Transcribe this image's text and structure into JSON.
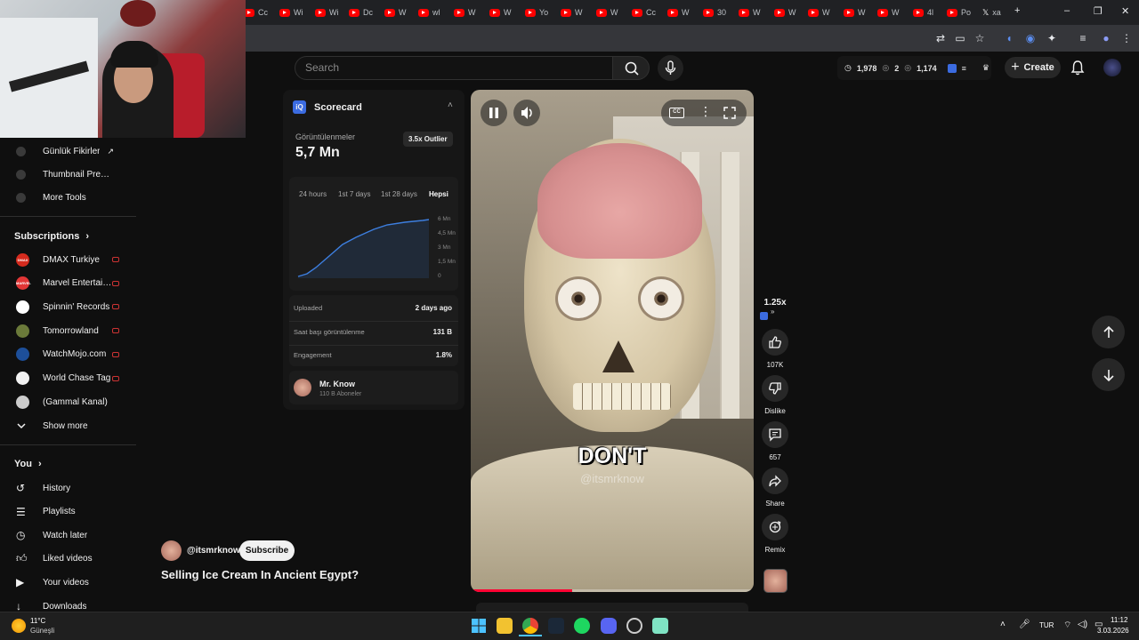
{
  "browser": {
    "tabs": [
      "Cc",
      "Wi",
      "Wi",
      "Dc",
      "W",
      "wl",
      "W",
      "W",
      "Yo",
      "W",
      "W",
      "Cc",
      "W",
      "30",
      "W",
      "W",
      "W",
      "W",
      "W",
      "4l",
      "Po",
      "xa"
    ],
    "new_tab": "+",
    "window_controls": [
      "–",
      "❐",
      "✕"
    ]
  },
  "header": {
    "search_placeholder": "Search",
    "stats": {
      "value1": "1,978",
      "value2": "2",
      "value3": "1,174"
    },
    "create_label": "Create"
  },
  "sidebar": {
    "tools": [
      {
        "label": "Günlük Fikirler",
        "icon": "external-link-icon"
      },
      {
        "label": "Thumbnail Preview"
      },
      {
        "label": "More Tools"
      }
    ],
    "subscriptions_title": "Subscriptions",
    "subscriptions": [
      {
        "label": "DMAX Turkiye",
        "color": "#d52b1e",
        "badge": "DMAX"
      },
      {
        "label": "Marvel Entertain...",
        "color": "#e23636",
        "badge": "MARVEL"
      },
      {
        "label": "Spinnin' Records",
        "color": "#ffffff",
        "badge": "S"
      },
      {
        "label": "Tomorrowland",
        "color": "#6b7a3a",
        "badge": ""
      },
      {
        "label": "WatchMojo.com",
        "color": "#1d4f9a",
        "badge": ""
      },
      {
        "label": "World Chase Tag",
        "color": "#f2f2f2",
        "badge": ""
      },
      {
        "label": "(Gammal Kanal)",
        "color": "#cccccc",
        "badge": ""
      }
    ],
    "show_more": "Show more",
    "you_title": "You",
    "you_items": [
      {
        "label": "History"
      },
      {
        "label": "Playlists"
      },
      {
        "label": "Watch later"
      },
      {
        "label": "Liked videos"
      },
      {
        "label": "Your videos"
      },
      {
        "label": "Downloads"
      }
    ]
  },
  "scorecard": {
    "title": "Scorecard",
    "views_label": "Görüntülenmeler",
    "views_value": "5,7 Mn",
    "outlier_badge": "3.5x Outlier",
    "tabs": [
      "24 hours",
      "1st 7 days",
      "1st 28 days",
      "Hepsi"
    ],
    "active_tab": "Hepsi",
    "y_ticks": [
      "6 Mn",
      "4,5 Mn",
      "3 Mn",
      "1,5 Mn",
      "0"
    ],
    "rows": [
      {
        "label": "Uploaded",
        "value": "2 days ago"
      },
      {
        "label": "Saat başı görüntülenme",
        "value": "131 B"
      },
      {
        "label": "Engagement",
        "value": "1.8%"
      }
    ],
    "channel_name": "Mr. Know",
    "channel_subs": "110 B Aboneler"
  },
  "video": {
    "caption": "DON'T",
    "watermark": "@itsmrknow",
    "channel_handle": "@itsmrknow",
    "subscribe_label": "Subscribe",
    "title": "Selling Ice Cream In Ancient Egypt?",
    "progress": 0.36,
    "cc_label": "CC"
  },
  "actions": {
    "speed": "1.25x",
    "likes": "107K",
    "dislike": "Dislike",
    "comments": "657",
    "share": "Share",
    "remix": "Remix"
  },
  "taskbar": {
    "temp": "11°C",
    "weather": "Güneşli",
    "lang": "TUR",
    "time": "11:12",
    "date": "3.03.2026"
  },
  "colors": {
    "accent_red": "#ff0033",
    "youtube_red": "#ff0000",
    "chart_line": "#3d7fe0"
  }
}
